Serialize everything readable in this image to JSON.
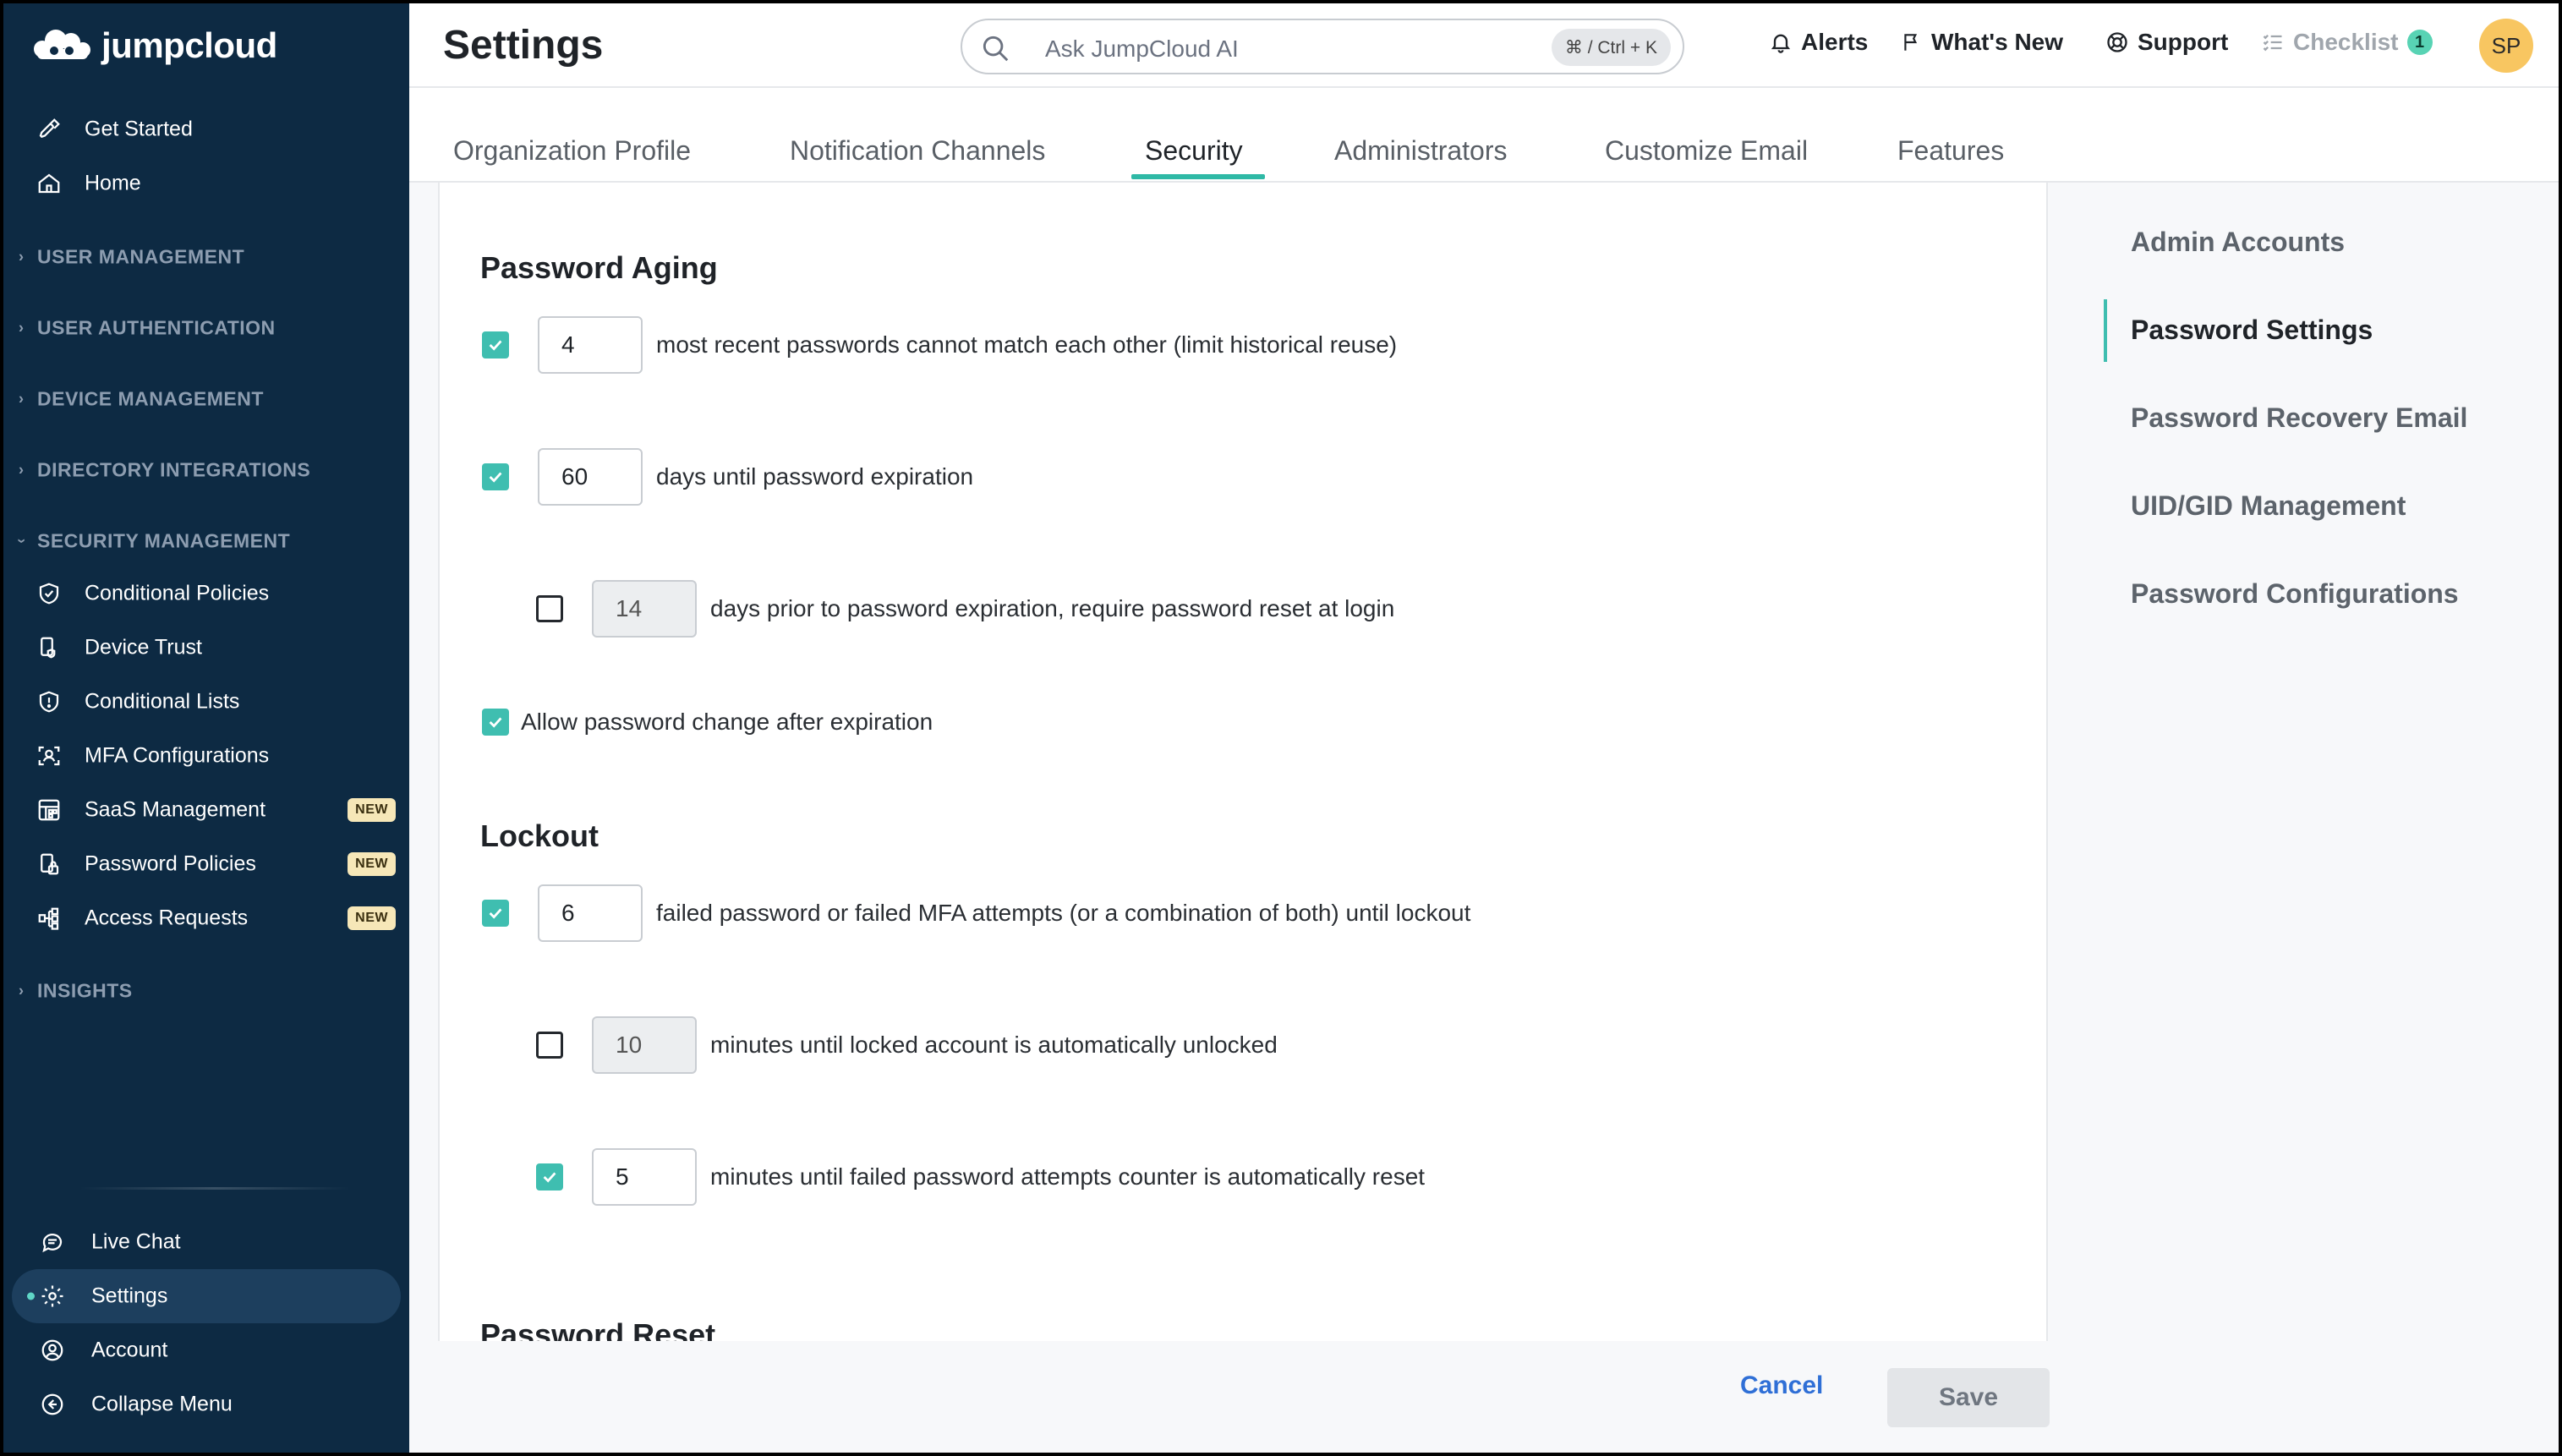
{
  "brand": {
    "name": "jumpcloud"
  },
  "sidebar": {
    "top_items": [
      {
        "label": "Get Started",
        "icon": "rocket-icon"
      },
      {
        "label": "Home",
        "icon": "home-icon"
      }
    ],
    "sections": [
      {
        "label": "USER MANAGEMENT",
        "expanded": false
      },
      {
        "label": "USER AUTHENTICATION",
        "expanded": false
      },
      {
        "label": "DEVICE MANAGEMENT",
        "expanded": false
      },
      {
        "label": "DIRECTORY INTEGRATIONS",
        "expanded": false
      },
      {
        "label": "SECURITY MANAGEMENT",
        "expanded": true
      },
      {
        "label": "INSIGHTS",
        "expanded": false
      }
    ],
    "security_items": [
      {
        "label": "Conditional Policies",
        "icon": "shield-check-icon",
        "badge": ""
      },
      {
        "label": "Device Trust",
        "icon": "device-trust-icon",
        "badge": ""
      },
      {
        "label": "Conditional Lists",
        "icon": "shield-list-icon",
        "badge": ""
      },
      {
        "label": "MFA Configurations",
        "icon": "mfa-scan-icon",
        "badge": ""
      },
      {
        "label": "SaaS Management",
        "icon": "saas-grid-icon",
        "badge": "NEW"
      },
      {
        "label": "Password Policies",
        "icon": "password-policy-icon",
        "badge": "NEW"
      },
      {
        "label": "Access Requests",
        "icon": "access-tree-icon",
        "badge": "NEW"
      }
    ],
    "bottom_items": [
      {
        "label": "Live Chat",
        "icon": "chat-icon"
      },
      {
        "label": "Settings",
        "icon": "gear-icon",
        "active": true
      },
      {
        "label": "Account",
        "icon": "user-circle-icon"
      },
      {
        "label": "Collapse Menu",
        "icon": "collapse-icon"
      }
    ]
  },
  "header": {
    "title": "Settings",
    "search_placeholder": "Ask JumpCloud AI",
    "search_shortcut": "⌘ / Ctrl + K",
    "alerts": "Alerts",
    "whats_new": "What's New",
    "support": "Support",
    "checklist": "Checklist",
    "checklist_count": "1",
    "avatar_initials": "SP"
  },
  "tabs": [
    "Organization Profile",
    "Notification Channels",
    "Security",
    "Administrators",
    "Customize Email",
    "Features"
  ],
  "active_tab": "Security",
  "password_aging": {
    "title": "Password Aging",
    "history": {
      "checked": true,
      "value": "4",
      "text": "most recent passwords cannot match each other (limit historical reuse)"
    },
    "expiration": {
      "checked": true,
      "value": "60",
      "text": "days until password expiration"
    },
    "prior_reset": {
      "checked": false,
      "value": "14",
      "text": "days prior to password expiration, require password reset at login"
    },
    "allow_change": {
      "checked": true,
      "text": "Allow password change after expiration"
    }
  },
  "lockout": {
    "title": "Lockout",
    "failed_attempts": {
      "checked": true,
      "value": "6",
      "text": "failed password or failed MFA attempts (or a combination of both) until lockout"
    },
    "auto_unlock": {
      "checked": false,
      "value": "10",
      "text": "minutes until locked account is automatically unlocked"
    },
    "counter_reset": {
      "checked": true,
      "value": "5",
      "text": "minutes until failed password attempts counter is automatically reset"
    }
  },
  "password_reset": {
    "title": "Password Reset"
  },
  "subnav": [
    "Admin Accounts",
    "Password Settings",
    "Password Recovery Email",
    "UID/GID Management",
    "Password Configurations"
  ],
  "subnav_active": "Password Settings",
  "footer": {
    "cancel": "Cancel",
    "save": "Save"
  },
  "colors": {
    "sidebar_bg": "#0d2a43",
    "accent_teal": "#3fbeb0",
    "link_blue": "#2f6fd6",
    "new_badge": "#f6e7b8",
    "avatar": "#f8c661"
  }
}
